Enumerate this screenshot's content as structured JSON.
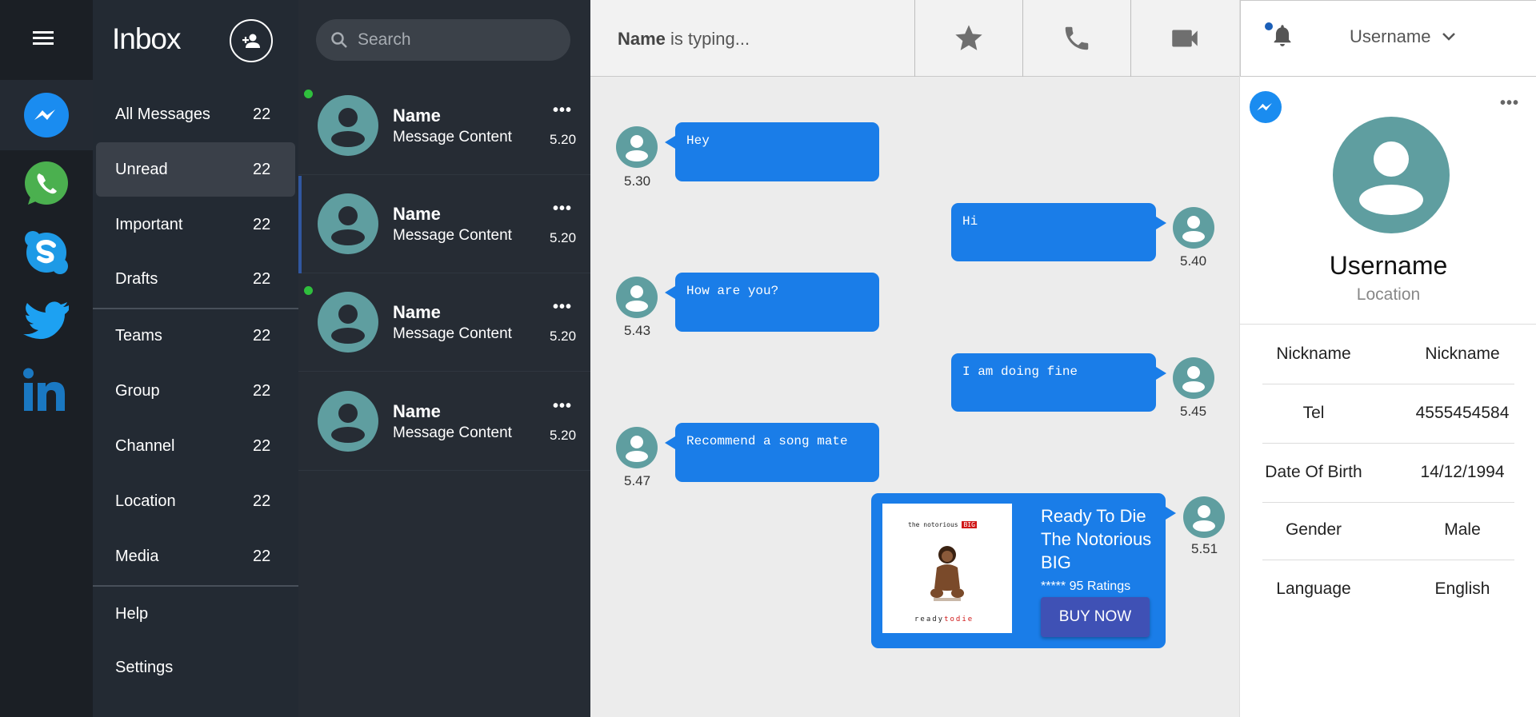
{
  "folders": {
    "title": "Inbox",
    "items": [
      {
        "label": "All Messages",
        "count": "22"
      },
      {
        "label": "Unread",
        "count": "22"
      },
      {
        "label": "Important",
        "count": "22"
      },
      {
        "label": "Drafts",
        "count": "22"
      },
      {
        "label": "Teams",
        "count": "22"
      },
      {
        "label": "Group",
        "count": "22"
      },
      {
        "label": "Channel",
        "count": "22"
      },
      {
        "label": "Location",
        "count": "22"
      },
      {
        "label": "Media",
        "count": "22"
      },
      {
        "label": "Help"
      },
      {
        "label": "Settings"
      }
    ]
  },
  "apps": [
    "messenger-icon",
    "whatsapp-icon",
    "skype-icon",
    "twitter-icon",
    "linkedin-icon"
  ],
  "search": {
    "placeholder": "Search"
  },
  "conversations": [
    {
      "name": "Name",
      "message": "Message Content",
      "time": "5.20",
      "online": true
    },
    {
      "name": "Name",
      "message": "Message Content",
      "time": "5.20",
      "online": false
    },
    {
      "name": "Name",
      "message": "Message Content",
      "time": "5.20",
      "online": true
    },
    {
      "name": "Name",
      "message": "Message Content",
      "time": "5.20",
      "online": false
    }
  ],
  "chat": {
    "typing_name": "Name",
    "typing_suffix": " is typing...",
    "messages": [
      {
        "text": "Hey",
        "time": "5.30",
        "side": "left"
      },
      {
        "text": "Hi",
        "time": "5.40",
        "side": "right"
      },
      {
        "text": "How are you?",
        "time": "5.43",
        "side": "left"
      },
      {
        "text": "I am doing fine",
        "time": "5.45",
        "side": "right"
      },
      {
        "text": "Recommend a song mate",
        "time": "5.47",
        "side": "left"
      }
    ],
    "product": {
      "time": "5.51",
      "title_line1": "Ready To Die",
      "title_line2": "The Notorious",
      "title_line3": "BIG",
      "stars": "*****",
      "ratings": "95 Ratings",
      "buy_label": "BUY NOW",
      "album_band": "the notorious",
      "album_band_accent": "BIG",
      "album_sub": "ready",
      "album_sub_accent": "todie"
    }
  },
  "profile": {
    "header_username": "Username",
    "username": "Username",
    "location": "Location",
    "fields": [
      {
        "key": "Nickname",
        "value": "Nickname"
      },
      {
        "key": "Tel",
        "value": "4555454584"
      },
      {
        "key": "Date Of Birth",
        "value": "14/12/1994"
      },
      {
        "key": "Gender",
        "value": "Male"
      },
      {
        "key": "Language",
        "value": "English"
      }
    ]
  },
  "colors": {
    "accent": "#1a7de8",
    "avatar": "#5f9ea0",
    "online": "#2fbf3d",
    "buy_button": "#3f51b5"
  }
}
